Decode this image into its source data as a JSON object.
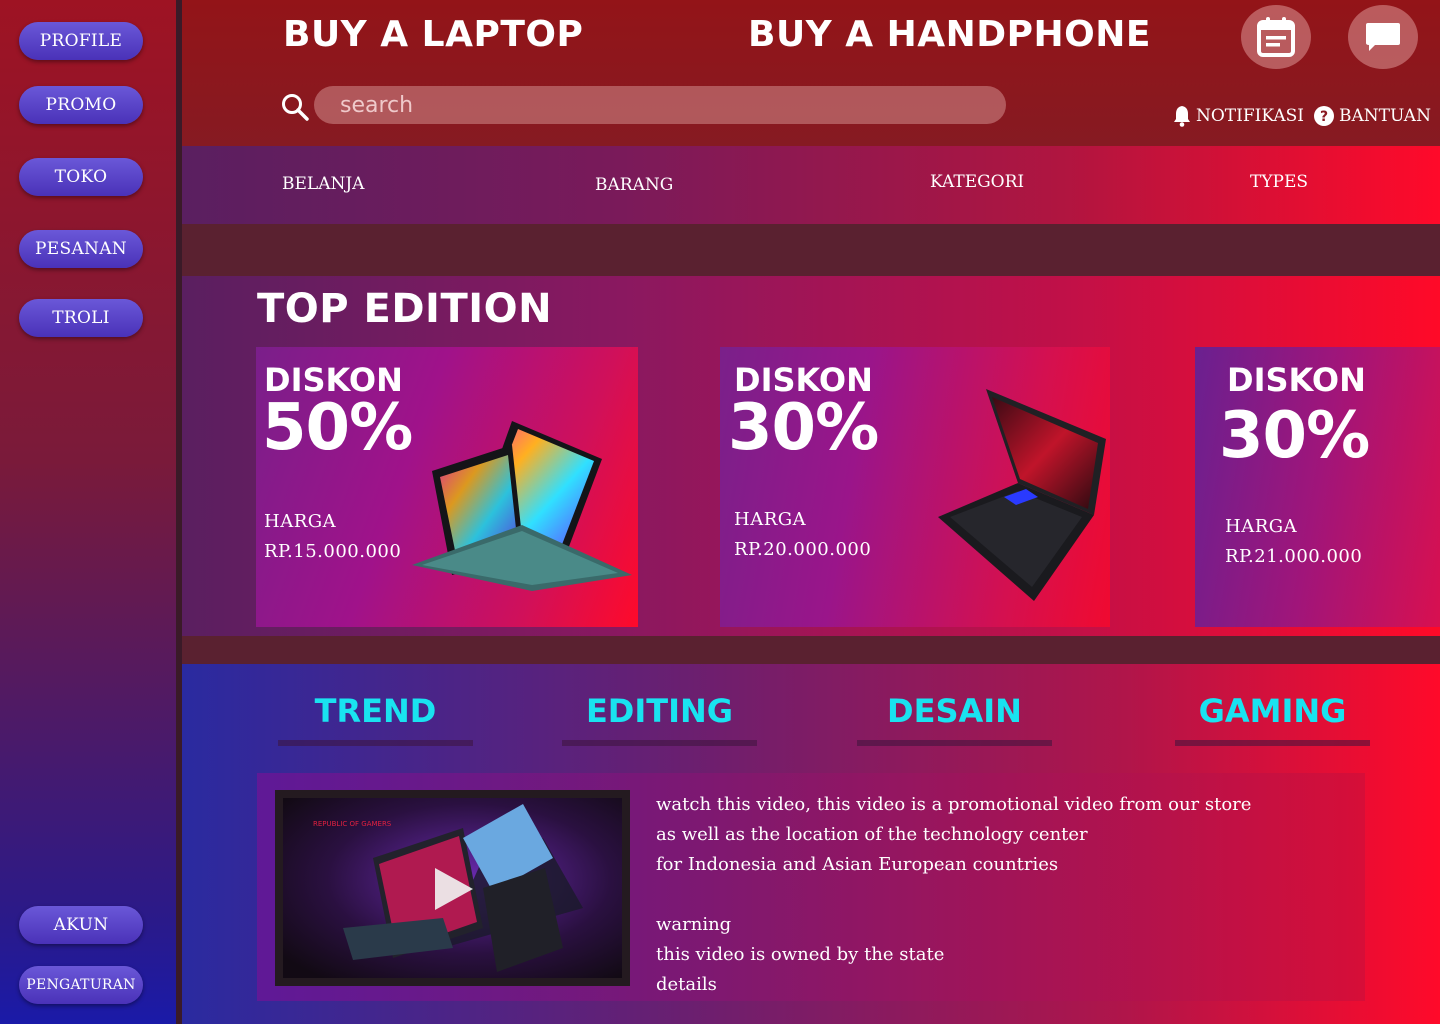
{
  "sidebar": {
    "items": [
      {
        "label": "PROFILE"
      },
      {
        "label": "PROMO"
      },
      {
        "label": "TOKO"
      },
      {
        "label": "PESANAN"
      },
      {
        "label": "TROLI"
      }
    ],
    "bottom": [
      {
        "label": "AKUN"
      },
      {
        "label": "PENGATURAN"
      }
    ]
  },
  "header": {
    "links": [
      "BUY A LAPTOP",
      "BUY A HANDPHONE"
    ],
    "icons": [
      "calendar-icon",
      "chat-icon"
    ],
    "search": {
      "placeholder": "search",
      "value": ""
    },
    "notifikasi": "NOTIFIKASI",
    "bantuan": "BANTUAN"
  },
  "nav": {
    "items": [
      "BELANJA",
      "BARANG",
      "KATEGORI",
      "TYPES"
    ]
  },
  "top_edition": {
    "title": "TOP EDITION",
    "cards": [
      {
        "diskon": "DISKON",
        "percent": "50%",
        "harga_label": "HARGA",
        "harga": "RP.15.000.000"
      },
      {
        "diskon": "DISKON",
        "percent": "30%",
        "harga_label": "HARGA",
        "harga": "RP.20.000.000"
      },
      {
        "diskon": "DISKON",
        "percent": "30%",
        "harga_label": "HARGA",
        "harga": "RP.21.000.000"
      }
    ]
  },
  "categories": {
    "tabs": [
      "TREND",
      "EDITING",
      "DESAIN",
      "GAMING"
    ],
    "video_text": [
      "watch this video, this video is a promotional video from our store",
      "as well as the location of the technology center",
      "for Indonesia and Asian European countries",
      "",
      "warning",
      "this video is owned by the state",
      "details"
    ]
  },
  "colors": {
    "accent_tab": "#19e3f0",
    "pill": "#5a42c8",
    "header": "#931418"
  }
}
